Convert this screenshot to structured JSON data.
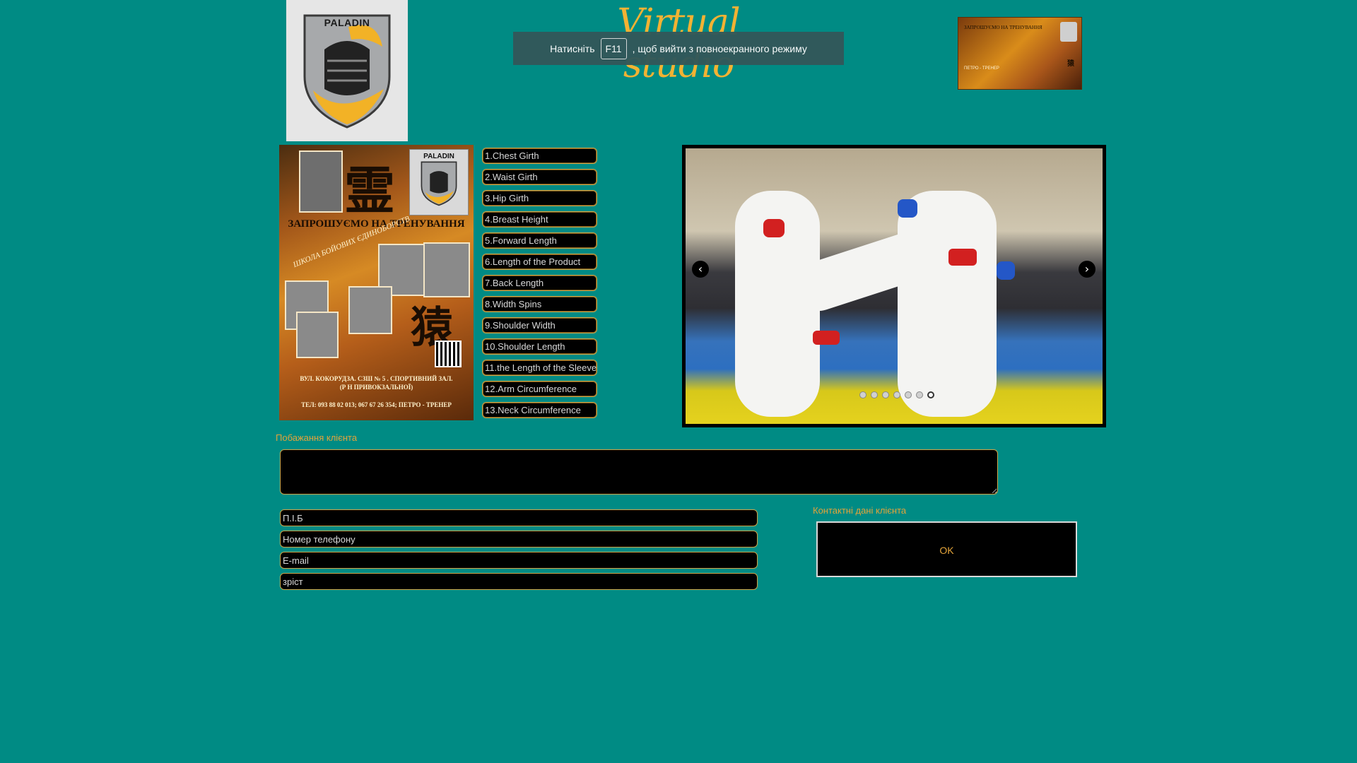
{
  "header": {
    "logo_text": "PALADIN",
    "title": "Virtual studio"
  },
  "fullscreen_notice": {
    "prefix": "Натисніть",
    "key": "F11",
    "suffix": ", щоб вийти з повноекранного режиму"
  },
  "top_banner": {
    "title": "ЗАПРОШУЄМО НА ТРЕНУВАННЯ",
    "name": "ПЕТРО - ТРЕНЕР"
  },
  "poster": {
    "logo_text": "PALADIN",
    "kanji_top": "霊",
    "kanji_bottom": "猿",
    "title": "ЗАПРОШУЄМО НА ТРЕНУВАННЯ",
    "school": "ШКОЛА БОЙОВИХ ЄДИНОБОРСТВ",
    "address_line1": "ВУЛ. КОКОРУДЗА. СЗШ № 5 . СПОРТИВНИЙ ЗАЛ.",
    "address_line2": "(Р Н ПРИВОКЗАЛЬНОЇ)",
    "phone": "ТЕЛ: 093 88 02 013; 067 67 26 354; ПЕТРО - ТРЕНЕР"
  },
  "measurements": [
    "1.Chest Girth",
    "2.Waist Girth",
    "3.Hip Girth",
    "4.Breast Height",
    "5.Forward Length",
    "6.Length of the Product",
    "7.Back Length",
    "8.Width Spins",
    "9.Shoulder Width",
    "10.Shoulder Length",
    "11.the Length of the Sleeve",
    "12.Arm Circumference",
    "13.Neck Circumference"
  ],
  "slider": {
    "prev_icon": "chevron-left-icon",
    "next_icon": "chevron-right-icon",
    "dot_count": 7,
    "active_dot": 7
  },
  "wishes": {
    "label": "Побажання клієнта",
    "value": ""
  },
  "contact": {
    "name_placeholder": "П.І.Б",
    "phone_placeholder": "Номер телефону",
    "email_placeholder": "E-mail",
    "height_placeholder": "зріст",
    "label": "Контактні дані клієнта",
    "ok_label": "OK"
  },
  "colors": {
    "background": "#008b84",
    "accent": "#e3a43a",
    "field_bg": "#000000"
  }
}
